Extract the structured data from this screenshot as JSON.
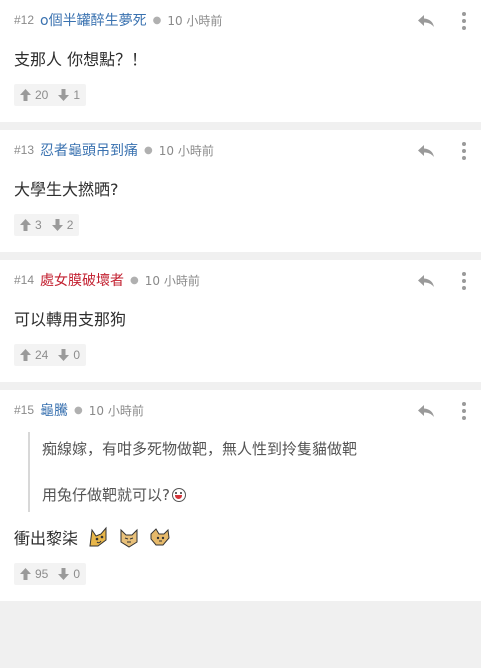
{
  "posts": [
    {
      "number": "#12",
      "username": "o個半罐醉生夢死",
      "username_color": "blue",
      "time": "10 小時前",
      "text": "支那人 你想點？！",
      "upvotes": "20",
      "downvotes": "1"
    },
    {
      "number": "#13",
      "username": "忍者龜頭吊到痛",
      "username_color": "blue",
      "time": "10 小時前",
      "text": "大學生大撚晒?",
      "upvotes": "3",
      "downvotes": "2"
    },
    {
      "number": "#14",
      "username": "處女膜破壞者",
      "username_color": "red",
      "time": "10 小時前",
      "text": "可以轉用支那狗",
      "upvotes": "24",
      "downvotes": "0"
    },
    {
      "number": "#15",
      "username": "龜騰",
      "username_color": "blue",
      "time": "10 小時前",
      "quote_line1": "痴線嫁，有咁多死物做靶，無人性到拎隻貓做靶",
      "quote_line2": "用兔仔做靶就可以?",
      "text": "衝出黎柒",
      "upvotes": "95",
      "downvotes": "0"
    }
  ],
  "icons": {
    "reply": "reply-arrow-icon",
    "more": "vertical-dots-icon",
    "upvote": "arrow-up-icon",
    "downvote": "arrow-down-icon"
  },
  "colors": {
    "username_blue": "#3a72b0",
    "username_red": "#c21f2f",
    "background": "#f0f0f0"
  }
}
